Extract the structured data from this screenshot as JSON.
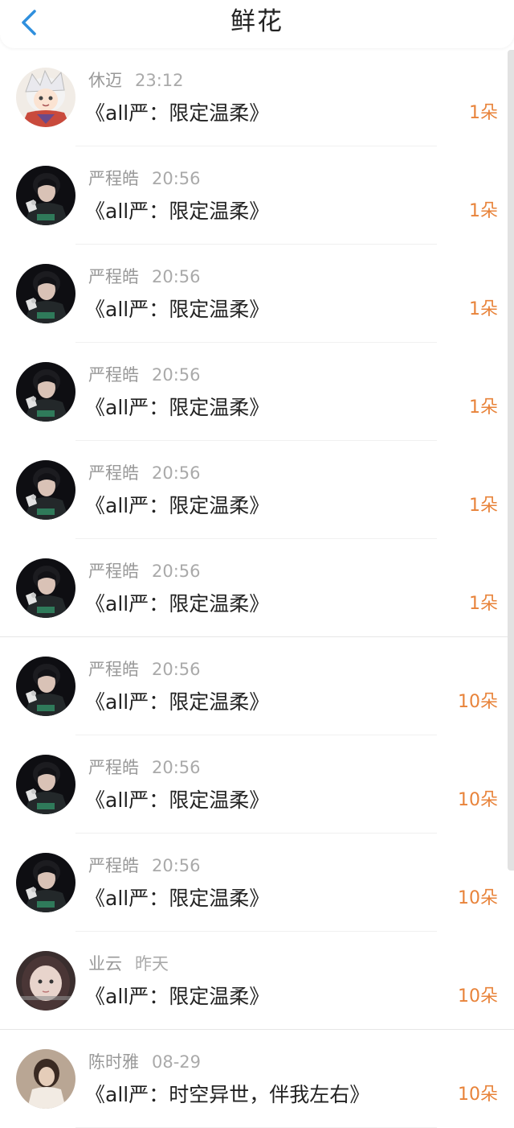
{
  "header": {
    "title": "鲜花",
    "back_icon": "chevron-left-icon",
    "accent": "#2f8fdd"
  },
  "colors": {
    "count": "#e8833a",
    "meta": "#999999"
  },
  "records": [
    {
      "name": "休迈",
      "time": "23:12",
      "work": "《all严：限定温柔》",
      "count": "1朵",
      "avatar": "anime-avatar"
    },
    {
      "name": "严程皓",
      "time": "20:56",
      "work": "《all严：限定温柔》",
      "count": "1朵",
      "avatar": "singer-avatar"
    },
    {
      "name": "严程皓",
      "time": "20:56",
      "work": "《all严：限定温柔》",
      "count": "1朵",
      "avatar": "singer-avatar"
    },
    {
      "name": "严程皓",
      "time": "20:56",
      "work": "《all严：限定温柔》",
      "count": "1朵",
      "avatar": "singer-avatar"
    },
    {
      "name": "严程皓",
      "time": "20:56",
      "work": "《all严：限定温柔》",
      "count": "1朵",
      "avatar": "singer-avatar"
    },
    {
      "name": "严程皓",
      "time": "20:56",
      "work": "《all严：限定温柔》",
      "count": "1朵",
      "avatar": "singer-avatar"
    },
    {
      "name": "严程皓",
      "time": "20:56",
      "work": "《all严：限定温柔》",
      "count": "10朵",
      "avatar": "singer-avatar"
    },
    {
      "name": "严程皓",
      "time": "20:56",
      "work": "《all严：限定温柔》",
      "count": "10朵",
      "avatar": "singer-avatar"
    },
    {
      "name": "严程皓",
      "time": "20:56",
      "work": "《all严：限定温柔》",
      "count": "10朵",
      "avatar": "singer-avatar"
    },
    {
      "name": "业云",
      "time": "昨天",
      "work": "《all严：限定温柔》",
      "count": "10朵",
      "avatar": "girl-avatar"
    },
    {
      "name": "陈时雅",
      "time": "08-29",
      "work": "《all严：时空异世，伴我左右》",
      "count": "10朵",
      "avatar": "photo-avatar"
    }
  ]
}
